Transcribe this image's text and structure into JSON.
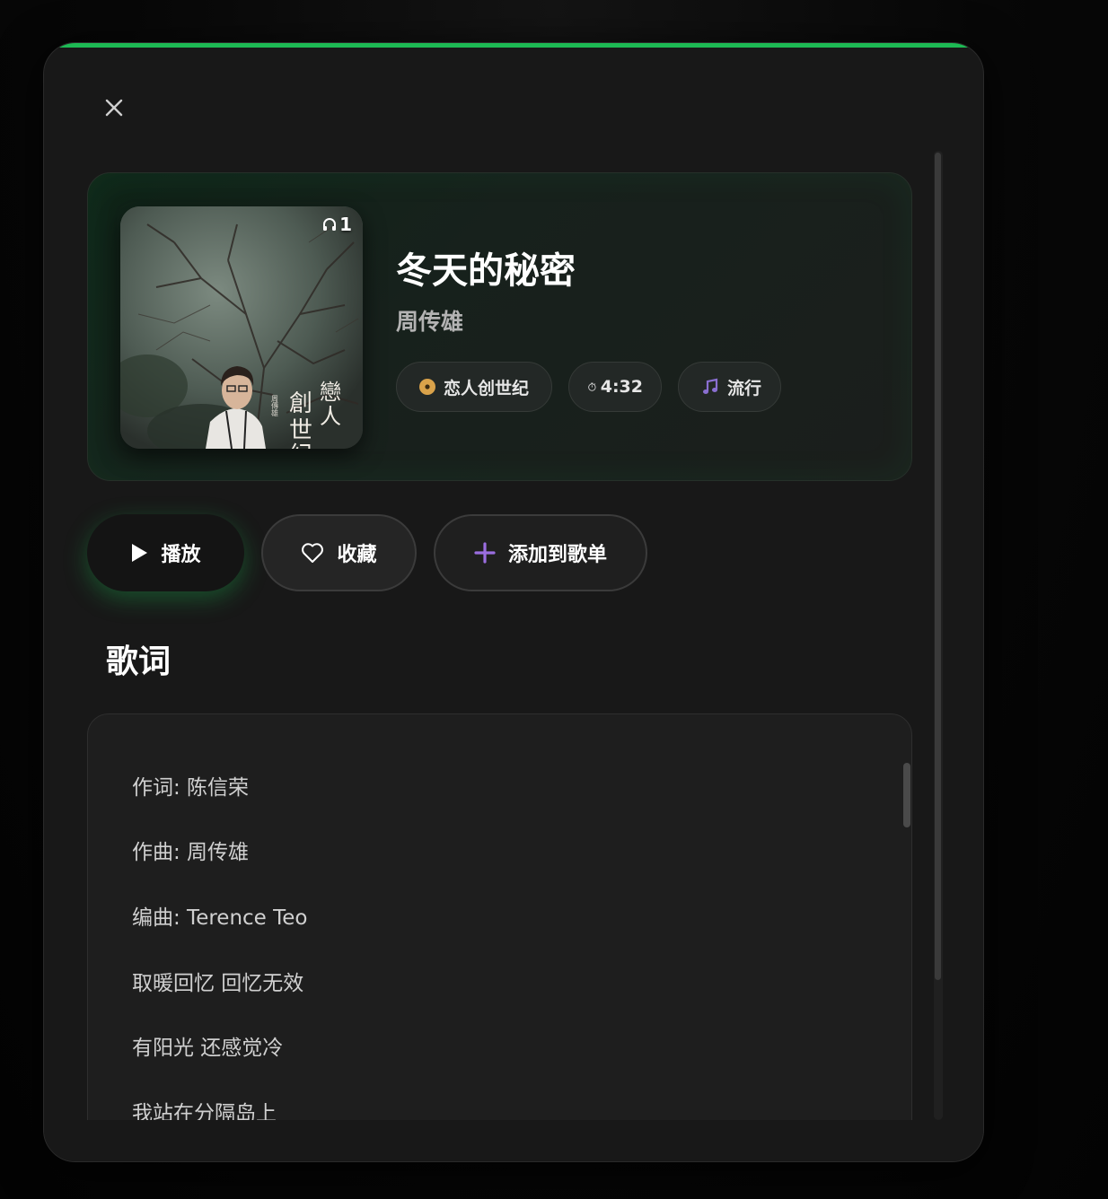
{
  "modal": {
    "close_icon": "close-icon",
    "accent_color": "#1db954"
  },
  "song": {
    "title": "冬天的秘密",
    "artist": "周传雄",
    "play_count": "1",
    "album": "恋人创世纪",
    "duration": "4:32",
    "genre": "流行",
    "cover_text": "戀人創世紀",
    "cover_artist_small": "周傳雄"
  },
  "actions": {
    "play_label": "播放",
    "favorite_label": "收藏",
    "add_to_playlist_label": "添加到歌单"
  },
  "lyrics": {
    "heading": "歌词",
    "lines": [
      "作词: 陈信荣",
      "作曲: 周传雄",
      "编曲: Terence Teo",
      "取暖回忆 回忆无效",
      "有阳光 还感觉冷",
      "我站在分隔岛上"
    ]
  },
  "colors": {
    "brand": "#1db954",
    "album_chip_icon": "#d9a24a",
    "genre_chip_icon": "#8a6fd1",
    "add_icon": "#9b6ee0"
  }
}
